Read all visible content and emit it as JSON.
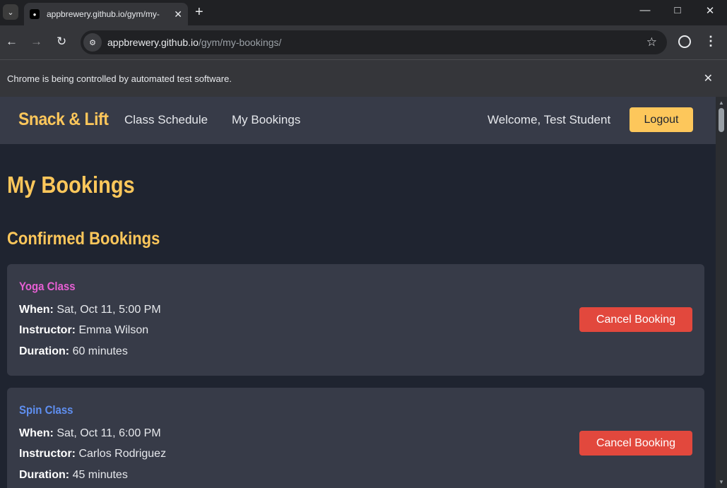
{
  "browser": {
    "tab_title": "appbrewery.github.io/gym/my-",
    "url_host": "appbrewery.github.io",
    "url_path": "/gym/my-bookings/",
    "infobar_text": "Chrome is being controlled by automated test software."
  },
  "header": {
    "brand": "Snack & Lift",
    "nav": [
      "Class Schedule",
      "My Bookings"
    ],
    "welcome": "Welcome, Test Student",
    "logout_label": "Logout"
  },
  "page": {
    "title": "My Bookings",
    "section_title": "Confirmed Bookings"
  },
  "labels": {
    "when": "When:",
    "instructor": "Instructor:",
    "duration": "Duration:"
  },
  "bookings": [
    {
      "class_name": "Yoga Class",
      "class_color": "#e65fd3",
      "when": "Sat, Oct 11, 5:00 PM",
      "instructor": "Emma Wilson",
      "duration": "60 minutes",
      "action_label": "Cancel Booking"
    },
    {
      "class_name": "Spin Class",
      "class_color": "#5f8ff0",
      "when": "Sat, Oct 11, 6:00 PM",
      "instructor": "Carlos Rodriguez",
      "duration": "45 minutes",
      "action_label": "Cancel Booking"
    }
  ]
}
